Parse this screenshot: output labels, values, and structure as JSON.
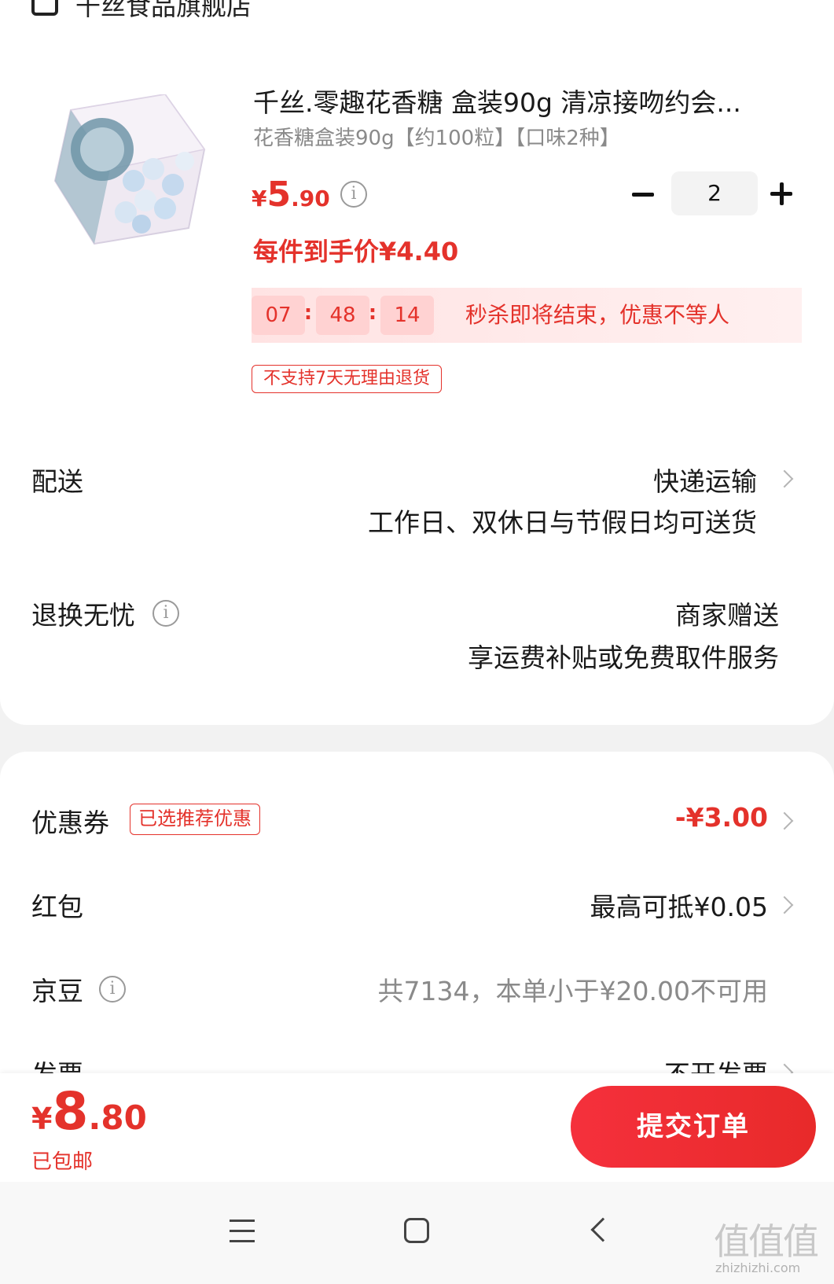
{
  "store": {
    "name": "千丝食品旗舰店",
    "icon": "store-icon"
  },
  "product": {
    "title": "千丝.零趣花香糖 盒装90g 清凉接吻约会...",
    "spec": "花香糖盒装90g【约100粒】【口味2种】",
    "price_currency": "¥",
    "price_int": "5",
    "price_dec": ".90",
    "per_unit_price": "每件到手价¥4.40",
    "quantity": "2",
    "countdown": {
      "h": "07",
      "m": "48",
      "s": "14",
      "sep": ":"
    },
    "flash_text": "秒杀即将结束，优惠不等人",
    "no_return_tag": "不支持7天无理由退货"
  },
  "delivery": {
    "label": "配送",
    "method": "快递运输",
    "detail": "工作日、双休日与节假日均可送货"
  },
  "return_service": {
    "label": "退换无忧",
    "title": "商家赠送",
    "detail": "享运费补贴或免费取件服务"
  },
  "coupon": {
    "label": "优惠券",
    "tag": "已选推荐优惠",
    "value": "-¥3.00"
  },
  "red_packet": {
    "label": "红包",
    "value": "最高可抵¥0.05"
  },
  "jd_beans": {
    "label": "京豆",
    "value": "共7134，本单小于¥20.00不可用"
  },
  "invoice": {
    "label": "发票",
    "value": "不开发票"
  },
  "footer": {
    "total_currency": "¥",
    "total_int": "8",
    "total_dec": ".80",
    "shipping": "已包邮",
    "submit_label": "提交订单"
  },
  "watermark": {
    "text": "值值值",
    "sub": "zhizhizhi.com"
  },
  "colors": {
    "accent": "#e4322b",
    "text": "#1a1a1a",
    "muted": "#8a8a8a"
  }
}
